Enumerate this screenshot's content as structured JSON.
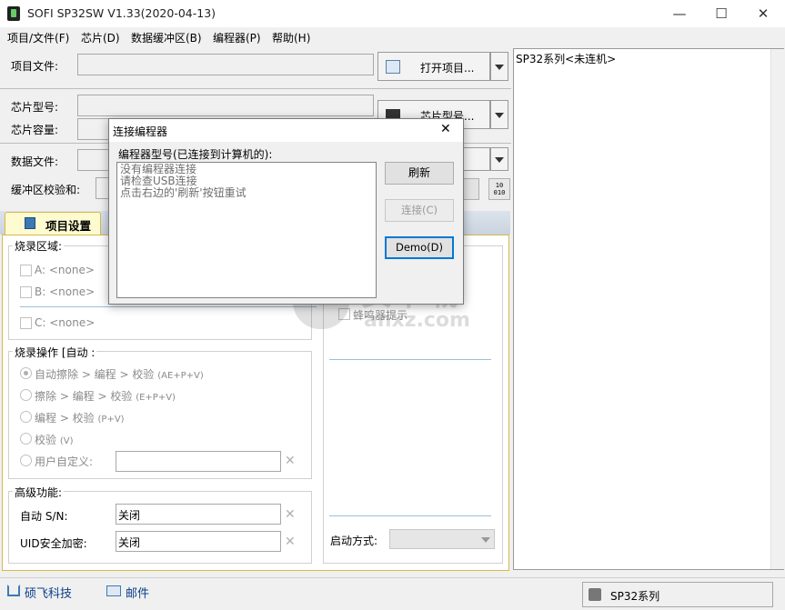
{
  "window": {
    "title": "SOFI SP32SW V1.33(2020-04-13)",
    "minimize_glyph": "—",
    "maximize_glyph": "☐",
    "close_glyph": "✕"
  },
  "menu": [
    "项目/文件(F)",
    "芯片(D)",
    "数据缓冲区(B)",
    "编程器(P)",
    "帮助(H)"
  ],
  "top_section": {
    "project_file_label": "项目文件:",
    "open_project_button": "打开项目...",
    "chip_model_label": "芯片型号:",
    "chip_capacity_label": "芯片容量:",
    "chip_model_button": "芯片型号...",
    "data_file_label": "数据文件:",
    "buffer_checksum_label": "缓冲区校验和:",
    "hex_icon_text": "10\n010"
  },
  "right_panel": {
    "status_text": "SP32系列<未连机>"
  },
  "tab": {
    "label": "项目设置"
  },
  "burn_area": {
    "title": "烧录区域:",
    "items": [
      {
        "label": "A: <none>",
        "checked": false
      },
      {
        "label": "B: <none>",
        "checked": false
      },
      {
        "label": "C: <none>",
        "checked": false
      }
    ]
  },
  "burn_operation": {
    "title": "烧录操作 [自动 :",
    "options": [
      {
        "label": "自动擦除 > 编程 > 校验",
        "suffix": "(AE+P+V)",
        "selected": true
      },
      {
        "label": "擦除 > 编程 > 校验",
        "suffix": "(E+P+V)",
        "selected": false
      },
      {
        "label": "编程 > 校验",
        "suffix": "(P+V)",
        "selected": false
      },
      {
        "label": "校验",
        "suffix": "(V)",
        "selected": false
      },
      {
        "label": "用户自定义:",
        "suffix": "",
        "selected": false
      }
    ]
  },
  "advanced": {
    "title": "高级功能:",
    "auto_sn_label": "自动 S/N:",
    "auto_sn_value": "关闭",
    "uid_label": "UID安全加密:",
    "uid_value": "关闭"
  },
  "right_group": {
    "buzzer_label": "蜂鸣器提示",
    "start_mode_label": "启动方式:"
  },
  "statusbar": {
    "company_link": "硕飞科技",
    "mail_link": "邮件",
    "device_label": "SP32系列"
  },
  "dialog": {
    "title": "连接编程器",
    "list_label": "编程器型号(已连接到计算机的):",
    "messages": [
      "没有编程器连接",
      "请检查USB连接",
      "点击右边的'刷新'按钮重试"
    ],
    "refresh_button": "刷新",
    "connect_button": "连接(C)",
    "demo_button": "Demo(D)",
    "close_glyph": "✕"
  },
  "watermark": {
    "text_cn": "安下载",
    "text_en": "anxz.com"
  },
  "colors": {
    "tab_bg": "#fffbd1",
    "tab_border": "#d7b94a",
    "accent_blue": "#0078d7"
  }
}
